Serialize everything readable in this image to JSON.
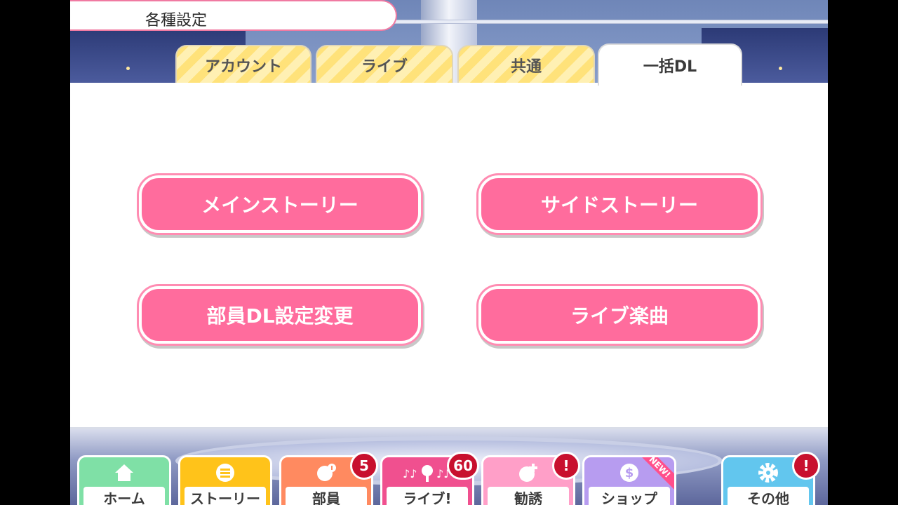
{
  "header": {
    "title": "各種設定"
  },
  "tabs": [
    {
      "label": "アカウント",
      "active": false
    },
    {
      "label": "ライブ",
      "active": false
    },
    {
      "label": "共通",
      "active": false
    },
    {
      "label": "一括DL",
      "active": true
    }
  ],
  "download": {
    "main_story": "メインストーリー",
    "side_story": "サイドストーリー",
    "member_dl": "部員DL設定変更",
    "live_songs": "ライブ楽曲"
  },
  "nav": [
    {
      "label": "ホーム",
      "icon": "home-icon",
      "color": "#7fe0a6"
    },
    {
      "label": "ストーリー",
      "icon": "story-icon",
      "color": "#ffc31a"
    },
    {
      "label": "部員",
      "icon": "member-icon",
      "color": "#ff8a60",
      "badge": "5"
    },
    {
      "label": "ライブ!",
      "icon": "live-icon",
      "color": "#f0508f",
      "badge": "60"
    },
    {
      "label": "勧誘",
      "icon": "scout-icon",
      "color": "#ff9fc8",
      "badge": "!"
    },
    {
      "label": "ショップ",
      "icon": "shop-icon",
      "color": "#b79cf0",
      "ribbon": "NEW!"
    },
    {
      "label": "その他",
      "icon": "gear-icon",
      "color": "#62c6ee",
      "badge": "!"
    }
  ]
}
